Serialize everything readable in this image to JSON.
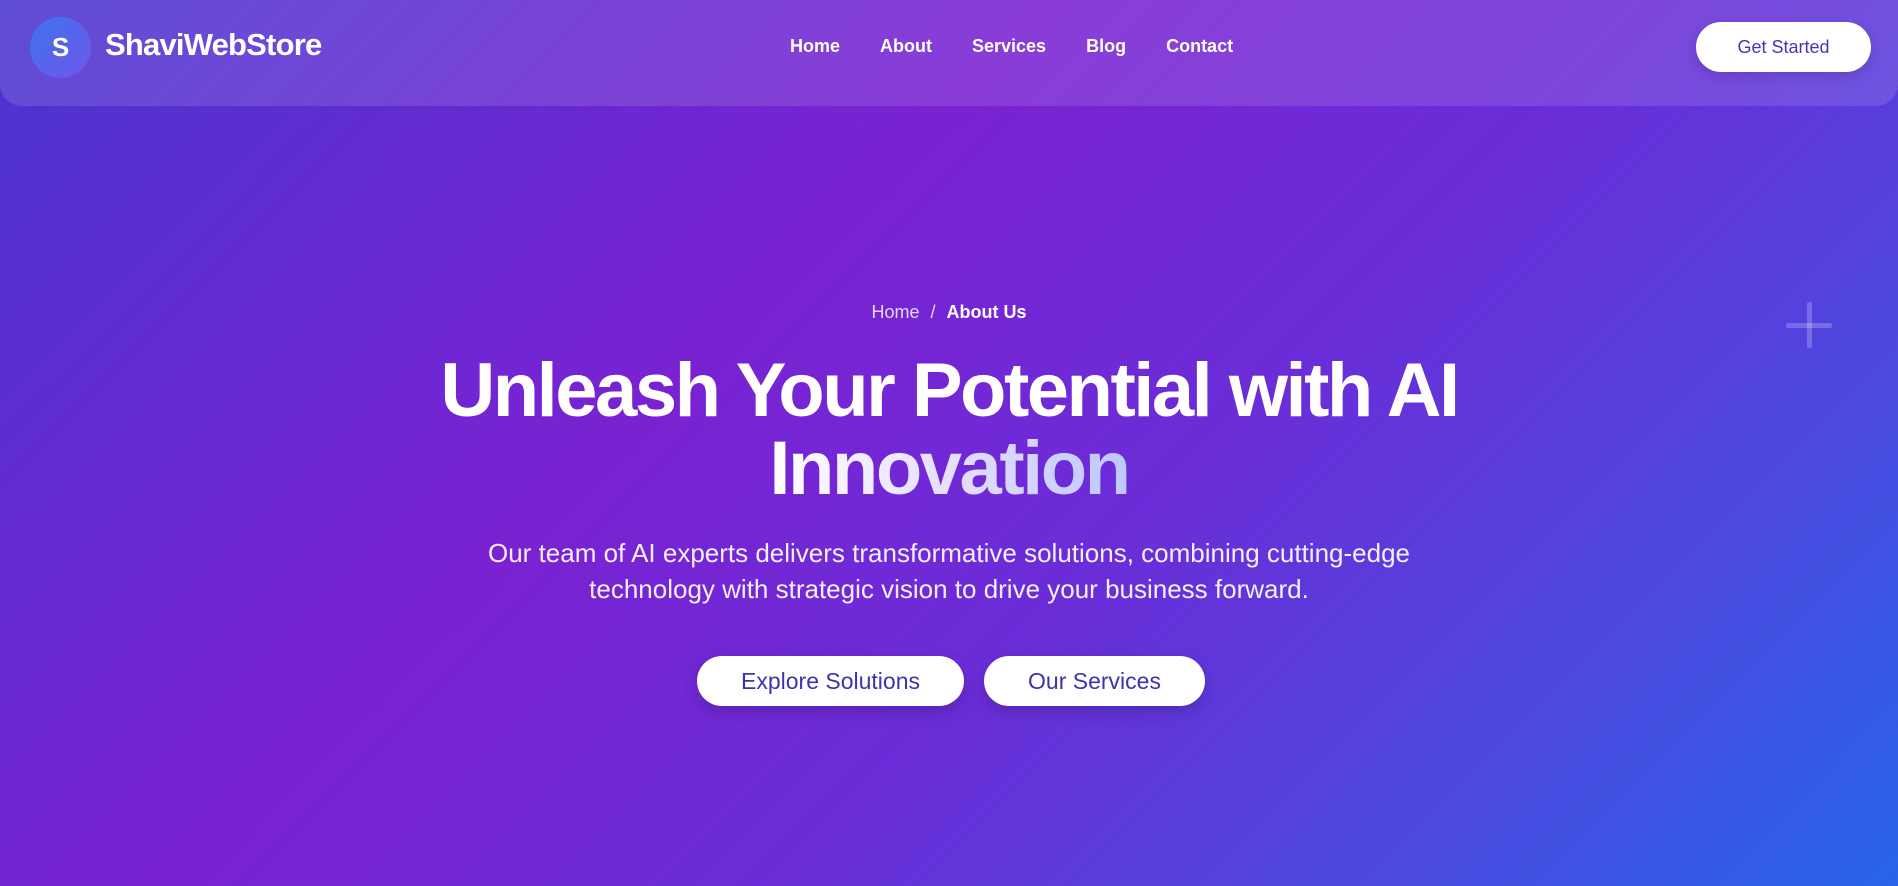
{
  "header": {
    "logo_letter": "S",
    "brand": "ShaviWebStore",
    "nav": [
      "Home",
      "About",
      "Services",
      "Blog",
      "Contact"
    ],
    "cta": "Get Started"
  },
  "breadcrumb": {
    "home": "Home",
    "separator": "/",
    "current": "About Us"
  },
  "hero": {
    "title_line1": "Unleash Your Potential with AI",
    "title_line2": "Innovation",
    "subtitle_line1": "Our team of AI experts delivers transformative solutions, combining cutting-edge",
    "subtitle_line2": "technology with strategic vision to drive your business forward.",
    "primary_button": "Explore Solutions",
    "secondary_button": "Our Services"
  },
  "colors": {
    "gradient_start": "#4a35d0",
    "gradient_mid": "#7a22d2",
    "gradient_end": "#2765ea",
    "button_text": "#4735b8"
  },
  "icons": {
    "decoration": "plus-icon"
  }
}
